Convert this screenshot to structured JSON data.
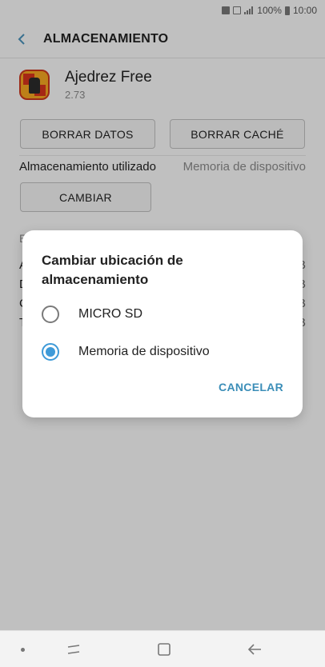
{
  "status_bar": {
    "battery": "100%",
    "time": "10:00"
  },
  "header": {
    "title": "ALMACENAMIENTO"
  },
  "app": {
    "name": "Ajedrez Free",
    "version": "2.73"
  },
  "buttons": {
    "clear_data": "BORRAR DATOS",
    "clear_cache": "BORRAR CACHÉ",
    "change": "CAMBIAR"
  },
  "storage": {
    "label": "Almacenamiento utilizado",
    "value": "Memoria de dispositivo"
  },
  "background": {
    "section_letter": "E",
    "rows": [
      {
        "letter": "A",
        "value": "B"
      },
      {
        "letter": "D",
        "value": "B"
      },
      {
        "letter": "C",
        "value": "B"
      },
      {
        "letter": "T",
        "value": "B"
      }
    ]
  },
  "dialog": {
    "title": "Cambiar ubicación de almacenamiento",
    "options": [
      {
        "label": "MICRO SD",
        "selected": false
      },
      {
        "label": "Memoria de dispositivo",
        "selected": true
      }
    ],
    "cancel": "CANCELAR"
  },
  "colors": {
    "accent": "#3e9ad8",
    "cancel": "#3b8eb8"
  }
}
